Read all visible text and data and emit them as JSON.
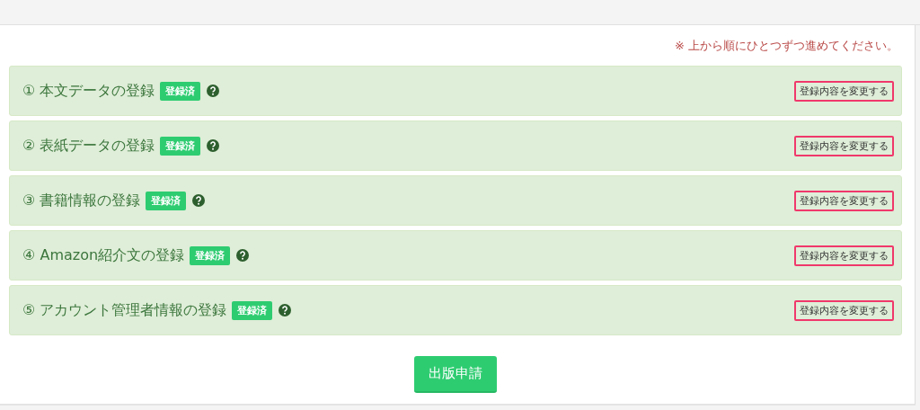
{
  "notice": "※ 上から順にひとつずつ進めてください。",
  "steps": [
    {
      "title": "① 本文データの登録",
      "status": "登録済",
      "action": "登録内容を変更する"
    },
    {
      "title": "② 表紙データの登録",
      "status": "登録済",
      "action": "登録内容を変更する"
    },
    {
      "title": "③ 書籍情報の登録",
      "status": "登録済",
      "action": "登録内容を変更する"
    },
    {
      "title": "④ Amazon紹介文の登録",
      "status": "登録済",
      "action": "登録内容を変更する"
    },
    {
      "title": "⑤ アカウント管理者情報の登録",
      "status": "登録済",
      "action": "登録内容を変更する"
    }
  ],
  "submit": "出版申請"
}
